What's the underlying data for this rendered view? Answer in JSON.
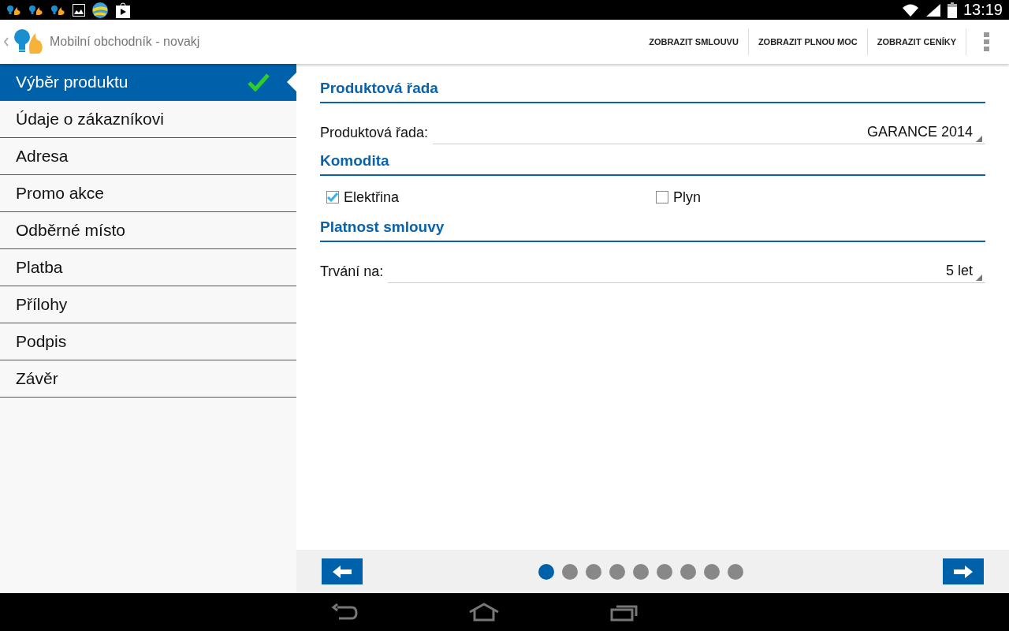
{
  "status_bar": {
    "time": "13:19"
  },
  "action_bar": {
    "title": "Mobilní obchodník - novakj",
    "actions": [
      "ZOBRAZIT SMLOUVU",
      "ZOBRAZIT PLNOU MOC",
      "ZOBRAZIT CENÍKY"
    ]
  },
  "sidebar": {
    "items": [
      {
        "label": "Výběr produktu",
        "selected": true,
        "completed": true
      },
      {
        "label": "Údaje o zákazníkovi",
        "selected": false,
        "completed": false
      },
      {
        "label": "Adresa",
        "selected": false,
        "completed": false
      },
      {
        "label": "Promo akce",
        "selected": false,
        "completed": false
      },
      {
        "label": "Odběrné místo",
        "selected": false,
        "completed": false
      },
      {
        "label": "Platba",
        "selected": false,
        "completed": false
      },
      {
        "label": "Přílohy",
        "selected": false,
        "completed": false
      },
      {
        "label": "Podpis",
        "selected": false,
        "completed": false
      },
      {
        "label": "Závěr",
        "selected": false,
        "completed": false
      }
    ]
  },
  "sections": [
    {
      "title": "Produktová řada",
      "rows": [
        {
          "kind": "dropdown",
          "label": "Produktová řada:",
          "value": "GARANCE 2014"
        }
      ]
    },
    {
      "title": "Komodita",
      "rows": [
        {
          "kind": "checkboxes",
          "options": [
            {
              "label": "Elektřina",
              "checked": true
            },
            {
              "label": "Plyn",
              "checked": false
            }
          ]
        }
      ]
    },
    {
      "title": "Platnost smlouvy",
      "rows": [
        {
          "kind": "dropdown",
          "label": "Trvání na:",
          "value": "5 let"
        }
      ]
    }
  ],
  "pager": {
    "pages": [
      {
        "selected": true
      },
      {
        "selected": false
      },
      {
        "selected": false
      },
      {
        "selected": false
      },
      {
        "selected": false
      },
      {
        "selected": false
      },
      {
        "selected": false
      },
      {
        "selected": false
      },
      {
        "selected": false
      }
    ]
  }
}
